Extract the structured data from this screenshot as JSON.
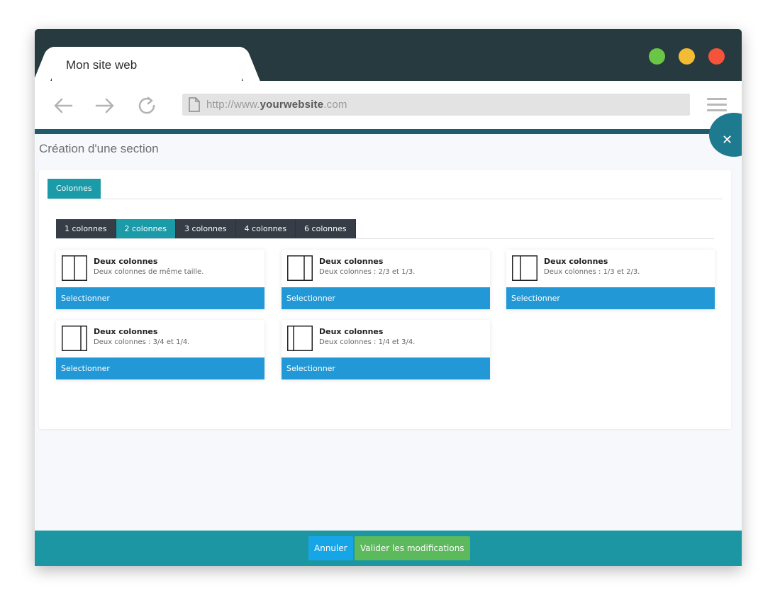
{
  "browser": {
    "tab_title": "Mon site web",
    "url_prefix": "http://www.",
    "url_domain": "yourwebsite",
    "url_suffix": ".com",
    "traffic_lights": [
      "#6cc645",
      "#f4bb35",
      "#f5543b"
    ]
  },
  "page": {
    "title": "Création d'une section",
    "panel_tab": "Colonnes",
    "column_tabs": [
      "1 colonnes",
      "2 colonnes",
      "3 colonnes",
      "4 colonnes",
      "6 colonnes"
    ],
    "active_tab": "2 colonnes",
    "cards": [
      {
        "title": "Deux colonnes",
        "description": "Deux colonnes de même taille.",
        "button": "Selectionner",
        "icon": "two-columns-equal-icon"
      },
      {
        "title": "Deux colonnes",
        "description": "Deux colonnes : 2/3 et 1/3.",
        "button": "Selectionner",
        "icon": "two-columns-wide-left-icon"
      },
      {
        "title": "Deux colonnes",
        "description": "Deux colonnes : 1/3 et 2/3.",
        "button": "Selectionner",
        "icon": "two-columns-wide-right-icon"
      },
      {
        "title": "Deux colonnes",
        "description": "Deux colonnes : 3/4 et 1/4.",
        "button": "Selectionner",
        "icon": "two-columns-three-quarter-left-icon"
      },
      {
        "title": "Deux colonnes",
        "description": "Deux colonnes : 1/4 et 3/4.",
        "button": "Selectionner",
        "icon": "two-columns-quarter-left-icon"
      }
    ]
  },
  "footer": {
    "cancel": "Annuler",
    "save": "Valider les modifications"
  },
  "colors": {
    "accent_teal": "#1b9aa8",
    "button_blue": "#2299d6",
    "save_green": "#5cb95c"
  }
}
